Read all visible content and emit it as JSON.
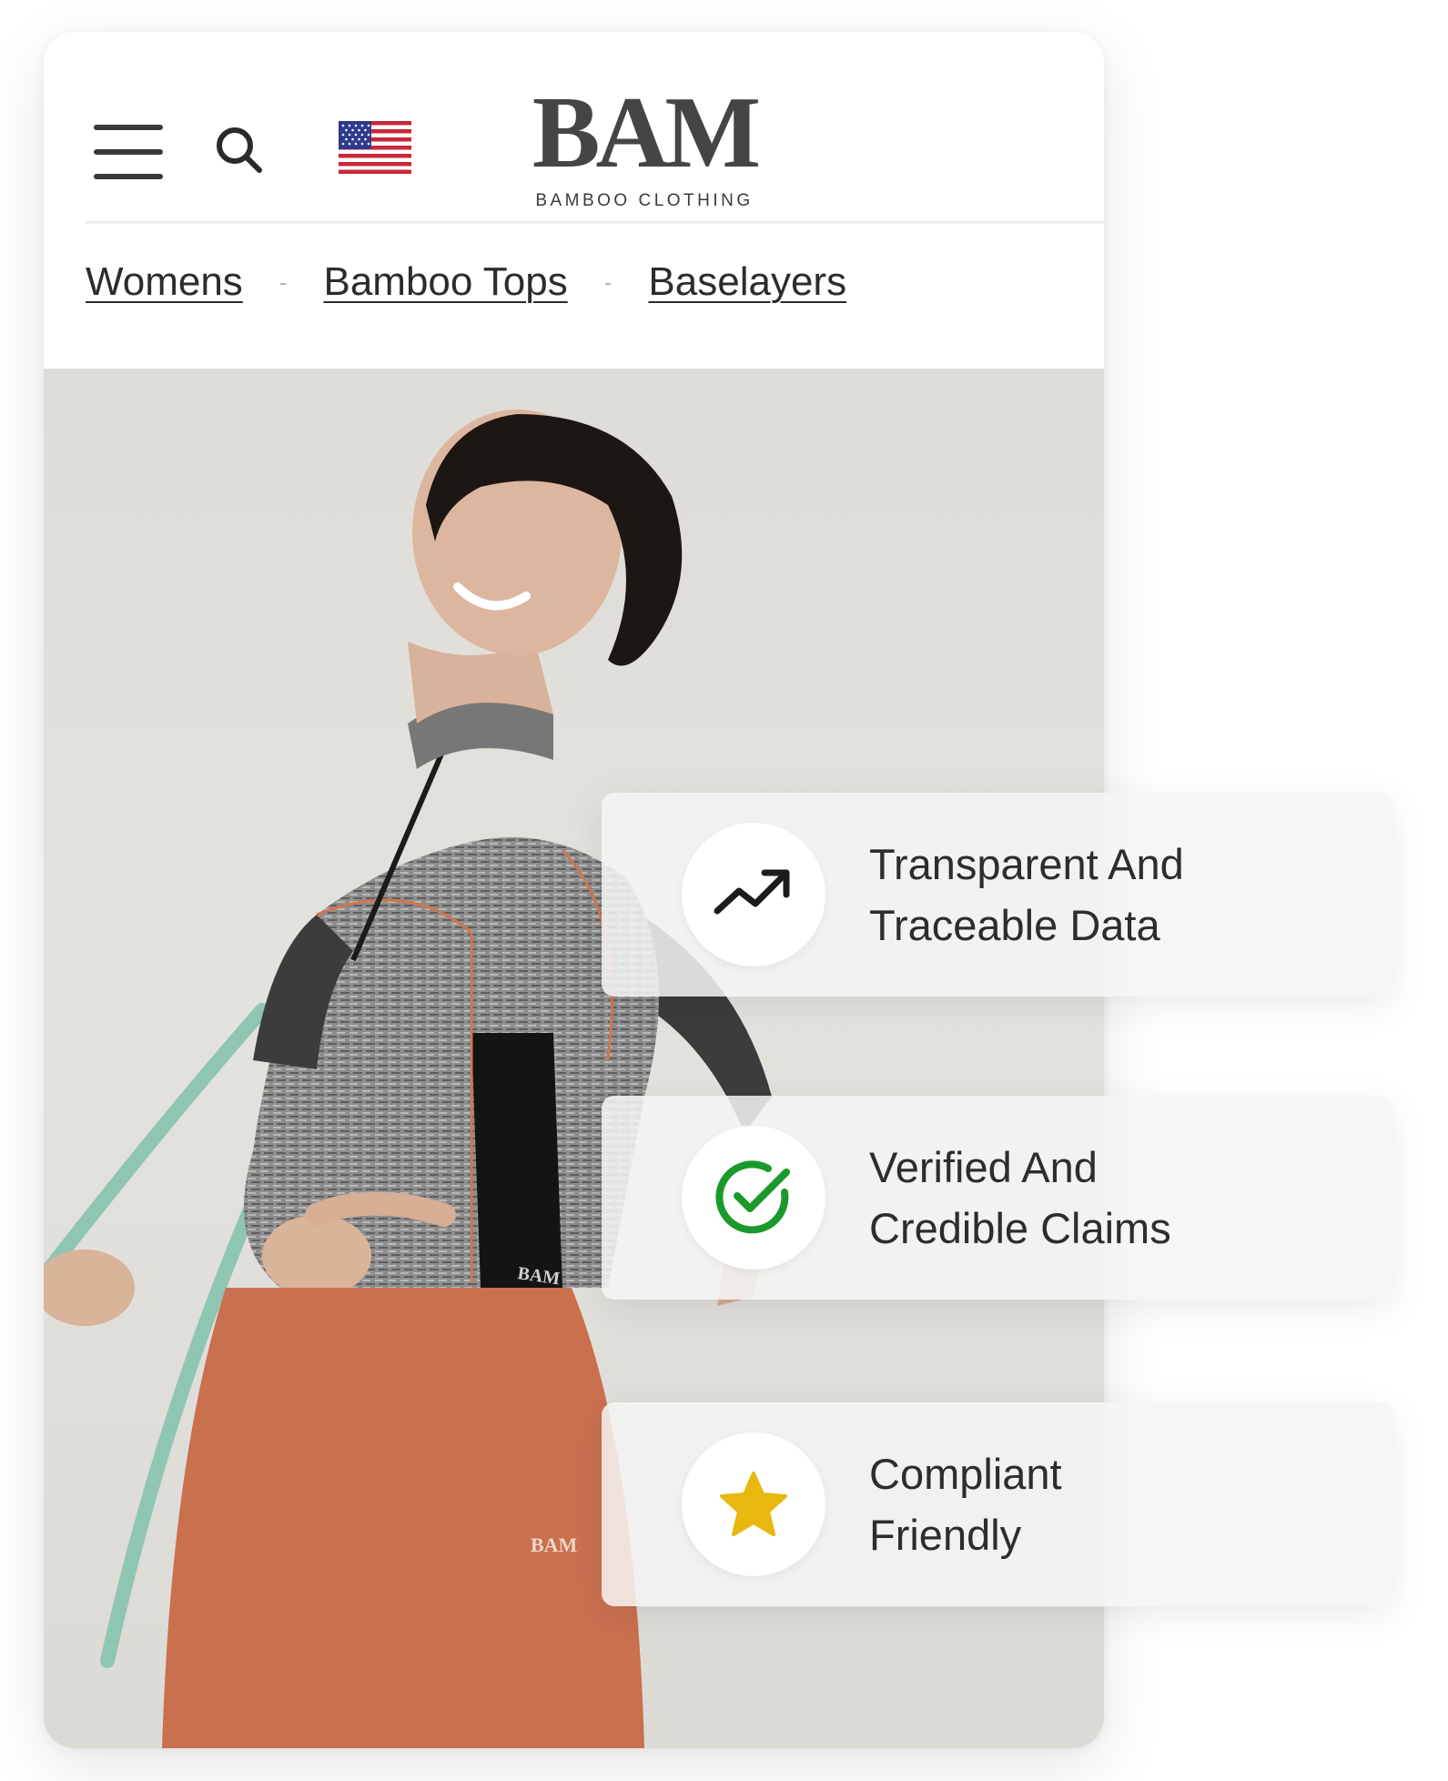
{
  "header": {
    "logo_main": "BAM",
    "logo_sub": "BAMBOO CLOTHING"
  },
  "icons": {
    "menu": "hamburger-menu-icon",
    "search": "search-icon",
    "flag": "us-flag-icon"
  },
  "breadcrumb": {
    "items": [
      "Womens",
      "Bamboo Tops",
      "Baselayers"
    ],
    "separator": "-"
  },
  "features": [
    {
      "icon": "trending-up-icon",
      "line1": "Transparent And",
      "line2": "Traceable Data",
      "icon_color": "#1c1c1c"
    },
    {
      "icon": "check-circle-icon",
      "line1": "Verified And",
      "line2": "Credible Claims",
      "icon_color": "#1a9a2a"
    },
    {
      "icon": "star-icon",
      "line1": "Compliant",
      "line2": "Friendly",
      "icon_color": "#e8b80f"
    }
  ],
  "garment_text": "BAM",
  "colors": {
    "text": "#2d2d2d",
    "leggings": "#c9704f",
    "band": "#8fc5b3"
  }
}
